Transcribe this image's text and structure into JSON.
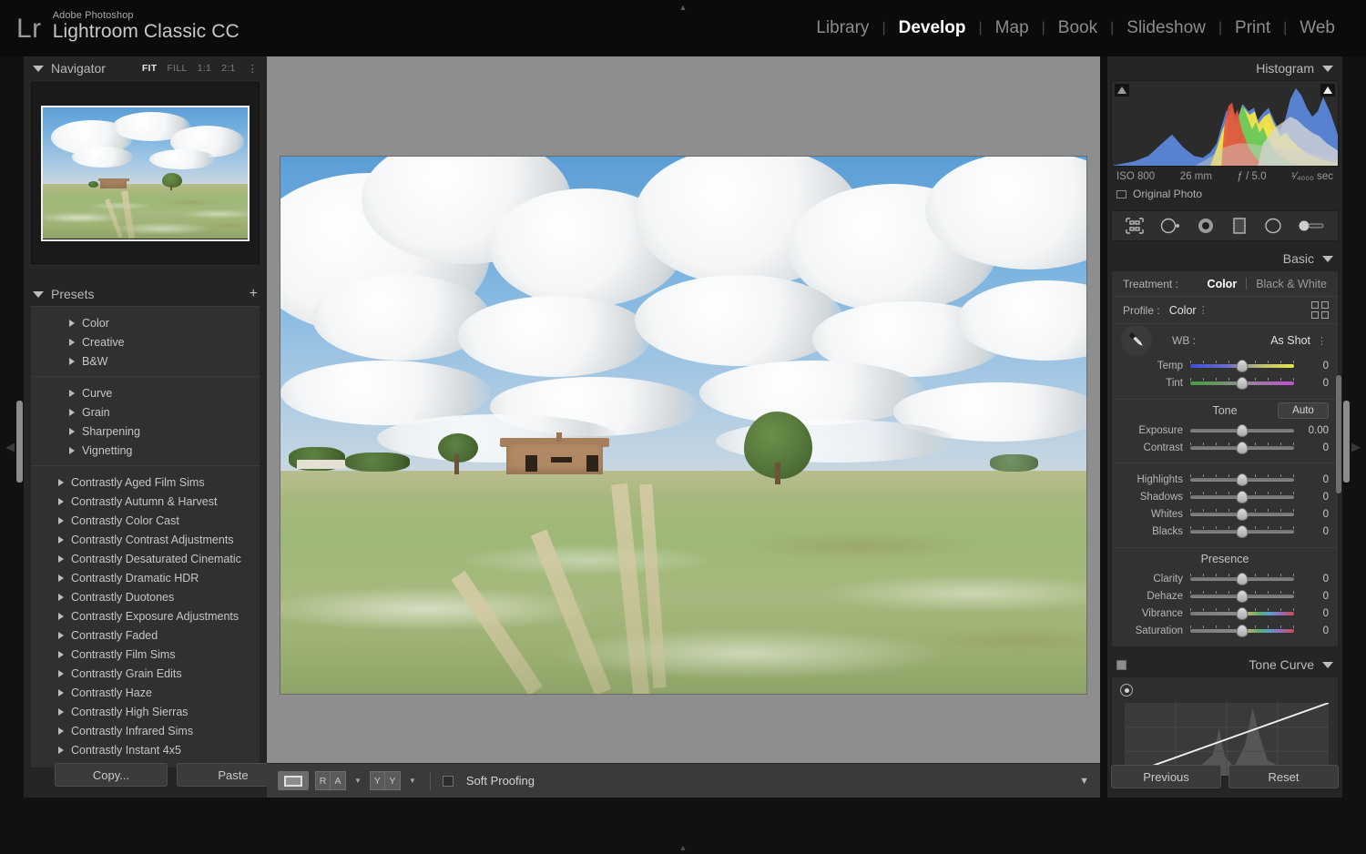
{
  "app": {
    "logo_mark": "Lr",
    "brand_line1": "Adobe Photoshop",
    "brand_line2": "Lightroom Classic CC"
  },
  "modules": [
    {
      "label": "Library",
      "active": false
    },
    {
      "label": "Develop",
      "active": true
    },
    {
      "label": "Map",
      "active": false
    },
    {
      "label": "Book",
      "active": false
    },
    {
      "label": "Slideshow",
      "active": false
    },
    {
      "label": "Print",
      "active": false
    },
    {
      "label": "Web",
      "active": false
    }
  ],
  "navigator": {
    "title": "Navigator",
    "zoom_levels": [
      {
        "label": "FIT",
        "active": true
      },
      {
        "label": "FILL",
        "active": false
      },
      {
        "label": "1:1",
        "active": false
      },
      {
        "label": "2:1",
        "active": false
      }
    ],
    "stepper_icon": "stepper-icon"
  },
  "presets": {
    "title": "Presets",
    "add_icon": "plus-icon",
    "groups": [
      {
        "items": [
          "Color",
          "Creative",
          "B&W"
        ]
      },
      {
        "items": [
          "Curve",
          "Grain",
          "Sharpening",
          "Vignetting"
        ]
      },
      {
        "items": [
          "Contrastly Aged Film Sims",
          "Contrastly Autumn & Harvest",
          "Contrastly Color Cast",
          "Contrastly Contrast Adjustments",
          "Contrastly Desaturated Cinematic",
          "Contrastly Dramatic HDR",
          "Contrastly Duotones",
          "Contrastly Exposure Adjustments",
          "Contrastly Faded",
          "Contrastly Film Sims",
          "Contrastly Grain Edits",
          "Contrastly Haze",
          "Contrastly High Sierras",
          "Contrastly Infrared Sims",
          "Contrastly Instant 4x5"
        ]
      }
    ],
    "copy_label": "Copy...",
    "paste_label": "Paste"
  },
  "toolbar": {
    "loupe_icon": "loupe-view-icon",
    "before_after": [
      "R",
      "A"
    ],
    "compare": [
      "Y",
      "Y"
    ],
    "soft_proofing_label": "Soft Proofing",
    "soft_proofing_checked": false,
    "caret_icon": "chevron-down-icon"
  },
  "histogram": {
    "title": "Histogram",
    "shadow_clip_icon": "shadow-clipping-icon",
    "highlight_clip_icon": "highlight-clipping-icon",
    "exif": {
      "iso": "ISO 800",
      "focal_length": "26 mm",
      "aperture": "ƒ / 5.0",
      "shutter": "¹⁄₄₀₀₀ sec"
    },
    "original_photo_label": "Original Photo",
    "original_photo_checked": false
  },
  "tools": [
    {
      "name": "crop-overlay-icon"
    },
    {
      "name": "spot-removal-icon"
    },
    {
      "name": "red-eye-correction-icon"
    },
    {
      "name": "graduated-filter-icon"
    },
    {
      "name": "radial-filter-icon"
    },
    {
      "name": "adjustment-brush-icon"
    }
  ],
  "basic": {
    "title": "Basic",
    "treatment_label": "Treatment :",
    "treatment_options": [
      {
        "label": "Color",
        "active": true
      },
      {
        "label": "Black & White",
        "active": false
      }
    ],
    "profile_label": "Profile :",
    "profile_value": "Color",
    "profile_browse_icon": "profile-browser-icon",
    "wb_eyedropper_icon": "white-balance-selector-icon",
    "wb_label": "WB :",
    "wb_value": "As Shot",
    "white_balance_sliders": [
      {
        "label": "Temp",
        "value": "0",
        "gradient": "temp"
      },
      {
        "label": "Tint",
        "value": "0",
        "gradient": "tint"
      }
    ],
    "tone_title": "Tone",
    "auto_label": "Auto",
    "tone_sliders": [
      {
        "label": "Exposure",
        "value": "0.00",
        "gradient": "plain"
      },
      {
        "label": "Contrast",
        "value": "0",
        "gradient": "plain"
      }
    ],
    "tone_sliders2": [
      {
        "label": "Highlights",
        "value": "0",
        "gradient": "plain"
      },
      {
        "label": "Shadows",
        "value": "0",
        "gradient": "plain"
      },
      {
        "label": "Whites",
        "value": "0",
        "gradient": "plain"
      },
      {
        "label": "Blacks",
        "value": "0",
        "gradient": "plain"
      }
    ],
    "presence_title": "Presence",
    "presence_sliders": [
      {
        "label": "Clarity",
        "value": "0",
        "gradient": "plain"
      },
      {
        "label": "Dehaze",
        "value": "0",
        "gradient": "plain"
      },
      {
        "label": "Vibrance",
        "value": "0",
        "gradient": "rainbow"
      },
      {
        "label": "Saturation",
        "value": "0",
        "gradient": "rainbow"
      }
    ]
  },
  "tone_curve": {
    "title": "Tone Curve",
    "target_adjust_icon": "targeted-adjustment-icon",
    "point_curve_icon": "point-curve-icon"
  },
  "right_buttons": {
    "previous_label": "Previous",
    "reset_label": "Reset"
  },
  "photo": {
    "alt": "rural landscape with farmhouse, oak tree and wildflower meadow"
  },
  "colors": {
    "panel_bg": "#252525",
    "canvas_bg": "#8e8e8e",
    "accent_text": "#ffffff",
    "muted_text": "#9a9a9a"
  }
}
